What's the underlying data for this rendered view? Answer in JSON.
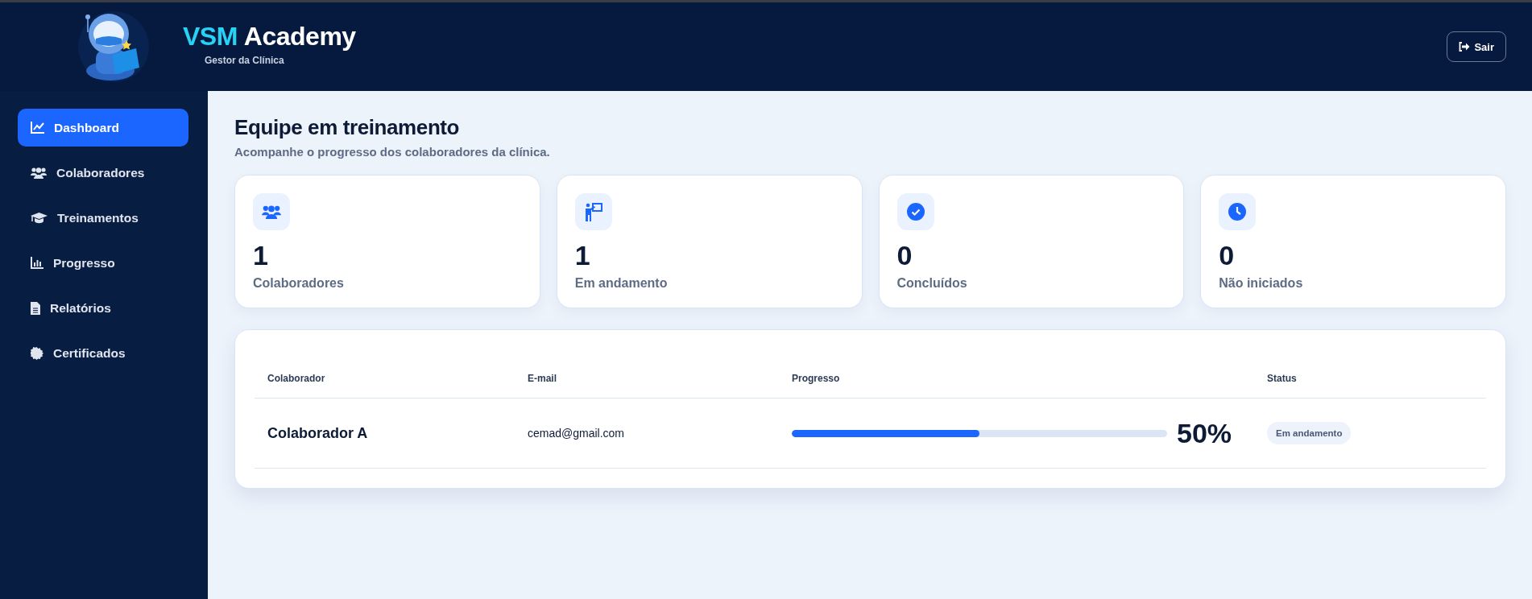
{
  "header": {
    "brand_accent": "VSM",
    "brand_name": "Academy",
    "subtitle": "Gestor da Clínica",
    "logout": "Sair"
  },
  "sidebar": {
    "items": [
      {
        "label": "Dashboard",
        "selected": true
      },
      {
        "label": "Colaboradores",
        "selected": false
      },
      {
        "label": "Treinamentos",
        "selected": false
      },
      {
        "label": "Progresso",
        "selected": false
      },
      {
        "label": "Relatórios",
        "selected": false
      },
      {
        "label": "Certificados",
        "selected": false
      }
    ]
  },
  "page": {
    "title": "Equipe em treinamento",
    "subtitle": "Acompanhe o progresso dos colaboradores da clínica."
  },
  "stats": [
    {
      "value": "1",
      "label": "Colaboradores"
    },
    {
      "value": "1",
      "label": "Em andamento"
    },
    {
      "value": "0",
      "label": "Concluídos"
    },
    {
      "value": "0",
      "label": "Não iniciados"
    }
  ],
  "table": {
    "columns": [
      "Colaborador",
      "E-mail",
      "Progresso",
      "Status"
    ],
    "rows": [
      {
        "name": "Colaborador A",
        "email": "cemad@gmail.com",
        "level": 0.5,
        "percent": "50%",
        "status": "Em andamento"
      }
    ]
  }
}
